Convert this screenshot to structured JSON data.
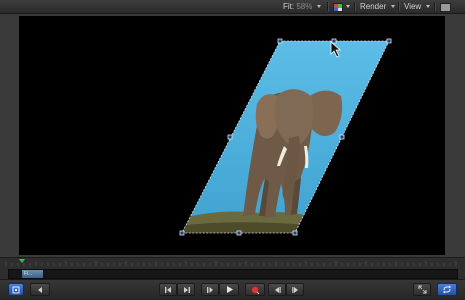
{
  "toolbar": {
    "fit_label": "Fit:",
    "zoom_value": "58%",
    "render_label": "Render",
    "view_label": "View"
  },
  "canvas": {
    "background": "#000000",
    "image_subject": "elephant"
  },
  "timeline": {
    "clip_label": "Fi..."
  },
  "transport": {
    "buttons": [
      "layer-toggle-icon",
      "back-icon",
      "go-to-start-icon",
      "step-back-icon",
      "play-icon",
      "step-forward-icon",
      "record-icon",
      "prev-keyframe-icon",
      "next-keyframe-icon",
      "fullscreen-icon",
      "loop-icon"
    ]
  },
  "colors": {
    "accent_blue": "#2f64c8",
    "record_red": "#d23a3a",
    "playhead_green": "#39c24a",
    "sky_blue": "#4fb0dc"
  }
}
